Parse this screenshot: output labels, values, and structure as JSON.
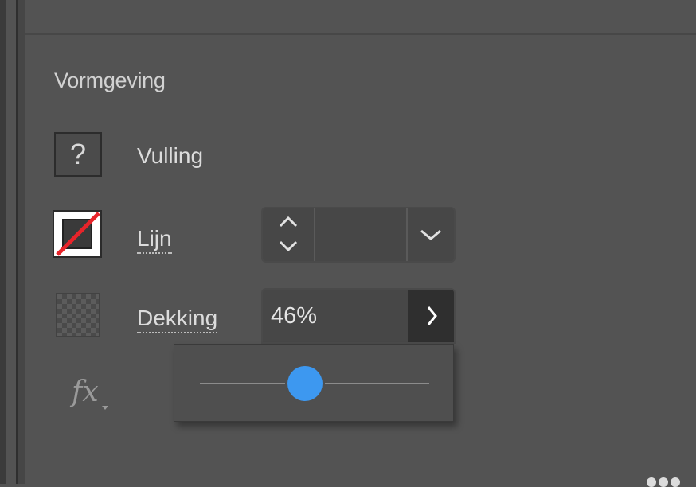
{
  "panel": {
    "section_title": "Vormgeving"
  },
  "fill": {
    "label": "Vulling",
    "swatch_glyph": "?"
  },
  "stroke": {
    "label": "Lijn",
    "width_value": ""
  },
  "opacity": {
    "label": "Dekking",
    "value": "46%",
    "slider_fraction": 0.46
  },
  "effects": {
    "label": "fx"
  },
  "colors": {
    "panel_bg": "#535353",
    "accent": "#3d98f0",
    "stroke_none_red": "#e8242a"
  }
}
